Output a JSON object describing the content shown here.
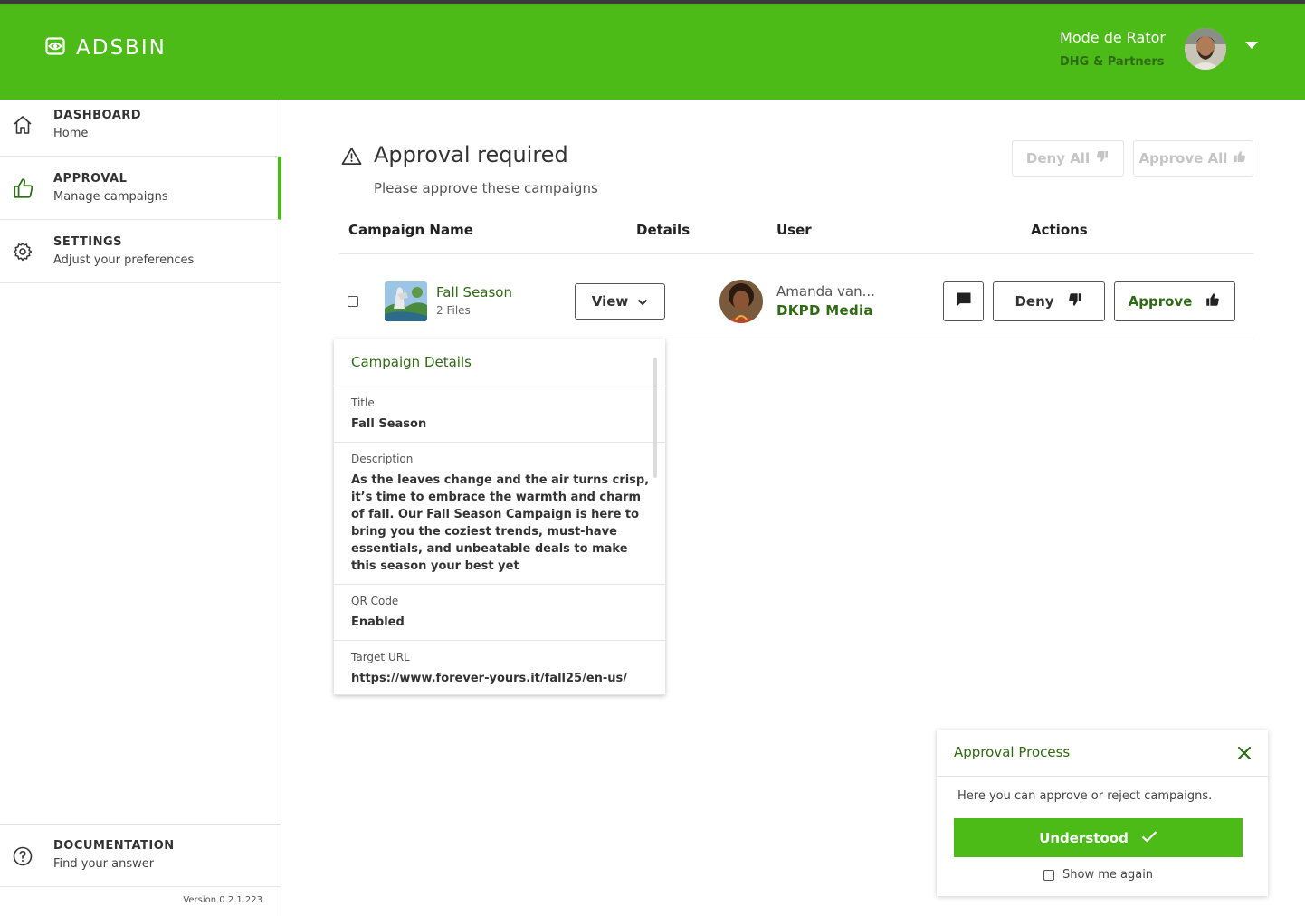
{
  "header": {
    "logo": "ADSBIN",
    "user_name": "Mode de Rator",
    "user_org": "DHG & Partners"
  },
  "sidebar": {
    "items": [
      {
        "title": "DASHBOARD",
        "subtitle": "Home"
      },
      {
        "title": "APPROVAL",
        "subtitle": "Manage campaigns"
      },
      {
        "title": "SETTINGS",
        "subtitle": "Adjust your preferences"
      }
    ],
    "documentation": {
      "title": "DOCUMENTATION",
      "subtitle": "Find your answer"
    },
    "version": "Version 0.2.1.223"
  },
  "main": {
    "title": "Approval required",
    "subtitle": "Please approve these campaigns",
    "deny_all": "Deny All",
    "approve_all": "Approve All",
    "columns": [
      "Campaign Name",
      "Details",
      "User",
      "Actions"
    ]
  },
  "row": {
    "campaign_name": "Fall Season",
    "files": "2 Files",
    "view_label": "View",
    "user_name": "Amanda van...",
    "user_org": "DKPD Media",
    "deny_label": "Deny",
    "approve_label": "Approve"
  },
  "details": {
    "heading": "Campaign Details",
    "fields": [
      {
        "label": "Title",
        "value": "Fall Season"
      },
      {
        "label": "Description",
        "value": "As the leaves change and the air turns crisp, it’s time to embrace the warmth and charm of fall. Our Fall Season Campaign is here to bring you the coziest trends, must-have essentials, and unbeatable deals to make this season your best yet"
      },
      {
        "label": "QR Code",
        "value": "Enabled"
      },
      {
        "label": "Target URL",
        "value": "https://www.forever-yours.it/fall25/en-us/"
      }
    ]
  },
  "toast": {
    "title": "Approval Process",
    "body": "Here you can approve or reject campaigns.",
    "button": "Understood",
    "checkbox_label": "Show me again"
  },
  "colors": {
    "brand": "#4cbb17",
    "brand_dark": "#2f6b12"
  }
}
